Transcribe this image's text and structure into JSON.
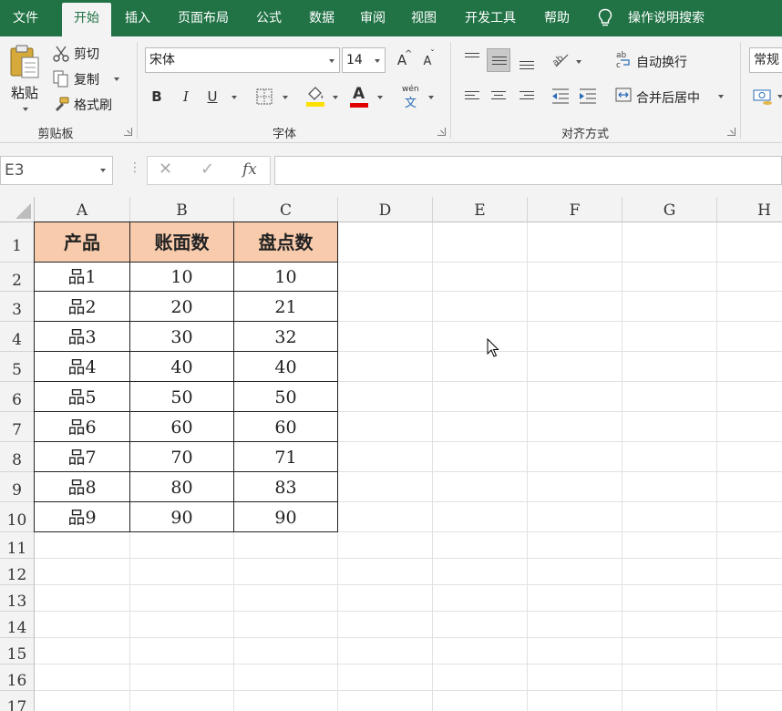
{
  "tabs": [
    "文件",
    "开始",
    "插入",
    "页面布局",
    "公式",
    "数据",
    "审阅",
    "视图",
    "开发工具",
    "帮助"
  ],
  "active_tab": "开始",
  "tell_me": "操作说明搜索",
  "colors": {
    "brand": "#217346",
    "header_fill": "#f8cbad",
    "ribbon_bg": "#f3f3f3"
  },
  "clipboard": {
    "paste": "粘贴",
    "cut": "剪切",
    "copy": "复制",
    "format_painter": "格式刷",
    "group_label": "剪贴板"
  },
  "font": {
    "name": "宋体",
    "size": "14",
    "group_label": "字体",
    "bold": "B",
    "italic": "I",
    "underline": "U",
    "grow": "A",
    "shrink": "A",
    "font_color_glyph": "A",
    "phonetic": "wén"
  },
  "alignment": {
    "wrap_text": "自动换行",
    "merge_center": "合并后居中",
    "group_label": "对齐方式"
  },
  "number": {
    "format": "常规"
  },
  "formula_bar": {
    "name_box": "E3",
    "cancel": "✕",
    "enter": "✓",
    "fx": "fx",
    "value": ""
  },
  "sheet": {
    "columns": [
      "A",
      "B",
      "C",
      "D",
      "E",
      "F",
      "G",
      "H"
    ],
    "rows": [
      "1",
      "2",
      "3",
      "4",
      "5",
      "6",
      "7",
      "8",
      "9",
      "10",
      "11",
      "12",
      "13",
      "14",
      "15",
      "16",
      "17"
    ],
    "header": [
      "产品",
      "账面数",
      "盘点数"
    ],
    "data": [
      [
        "品1",
        "10",
        "10"
      ],
      [
        "品2",
        "20",
        "21"
      ],
      [
        "品3",
        "30",
        "32"
      ],
      [
        "品4",
        "40",
        "40"
      ],
      [
        "品5",
        "50",
        "50"
      ],
      [
        "品6",
        "60",
        "60"
      ],
      [
        "品7",
        "70",
        "71"
      ],
      [
        "品8",
        "80",
        "83"
      ],
      [
        "品9",
        "90",
        "90"
      ]
    ]
  }
}
